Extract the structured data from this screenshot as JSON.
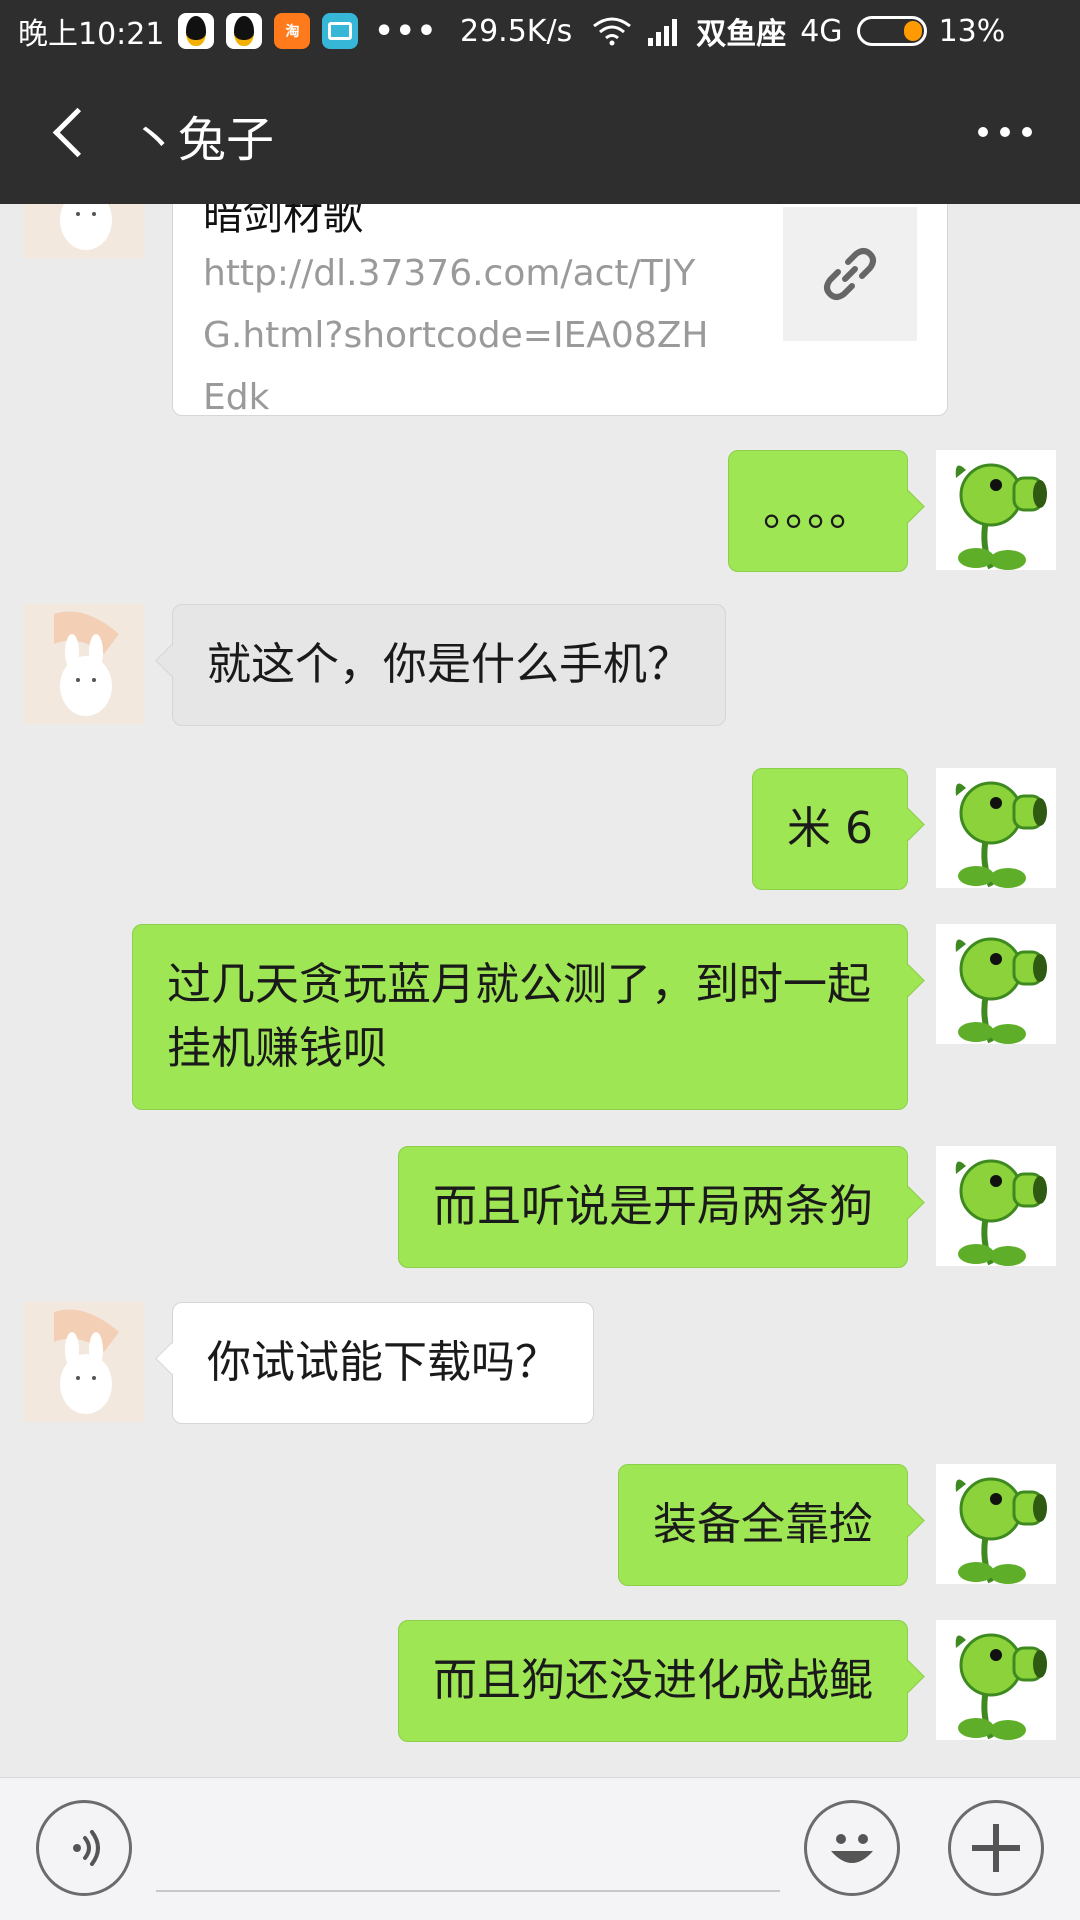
{
  "status_bar": {
    "time": "晚上10:21",
    "app_icons": [
      "qq-icon",
      "qq-icon",
      "taobao-icon",
      "screenshot-icon"
    ],
    "taobao_text": "淘",
    "more_dots": "•••",
    "speed": "29.5K/s",
    "carrier": "双鱼座",
    "network": "4G",
    "battery": "13%",
    "battery_level": 0.13
  },
  "header": {
    "title": "丶兔子",
    "back_icon": "back-arrow-icon",
    "more_icon": "more-dots-icon"
  },
  "link_card": {
    "title": "暗剑材歌",
    "url": "http://dl.37376.com/act/TJYG.html?shortcode=IEA08ZHEdk",
    "icon": "link-icon"
  },
  "messages": [
    {
      "from": "me",
      "text": "。。。。"
    },
    {
      "from": "them",
      "text": "就这个，你是什么手机？"
    },
    {
      "from": "me",
      "text": "米 6"
    },
    {
      "from": "me",
      "text": "过几天贪玩蓝月就公测了，到时一起挂机赚钱呗"
    },
    {
      "from": "me",
      "text": "而且听说是开局两条狗"
    },
    {
      "from": "them",
      "text": "你试试能下载吗？"
    },
    {
      "from": "me",
      "text": "装备全靠捡"
    },
    {
      "from": "me",
      "text": "而且狗还没进化成战鲲"
    }
  ],
  "input_bar": {
    "placeholder": "",
    "voice_icon": "voice-icon",
    "emoji_icon": "emoji-icon",
    "plus_icon": "plus-icon"
  },
  "colors": {
    "header_bg": "#2e2e2e",
    "chat_bg": "#ebebeb",
    "my_bubble": "#9ee654",
    "their_bubble": "#ffffff"
  }
}
